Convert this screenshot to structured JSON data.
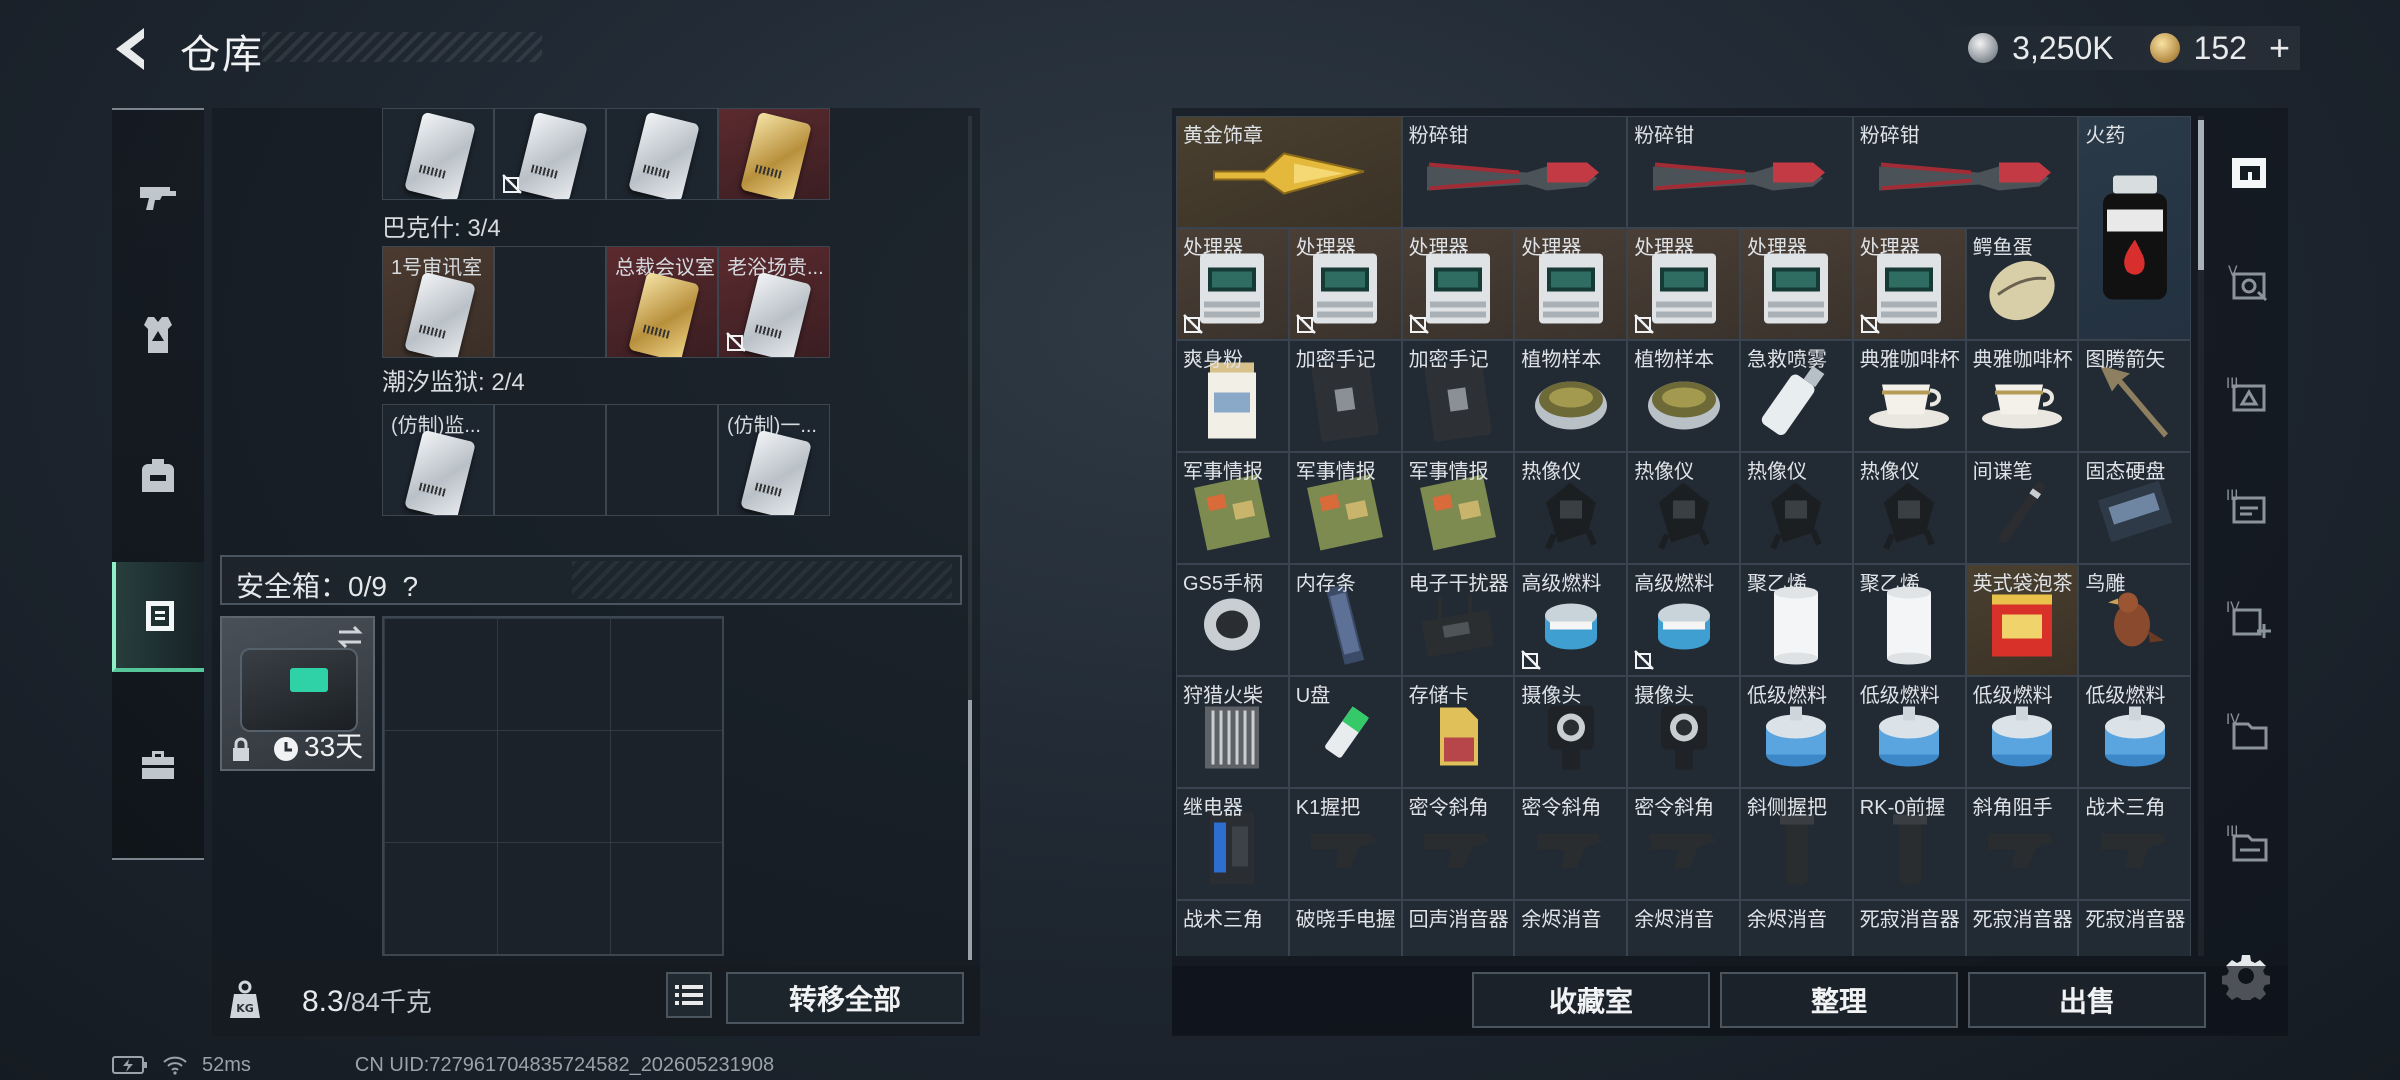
{
  "header": {
    "title": "仓库",
    "currency": [
      {
        "icon": "silver-coin-icon",
        "value": "3,250K"
      },
      {
        "icon": "gold-coin-icon",
        "value": "152"
      }
    ],
    "plus_label": "+"
  },
  "left_rail": {
    "items": [
      {
        "icon": "gun-icon",
        "active": false
      },
      {
        "icon": "armor-vest-icon",
        "active": false
      },
      {
        "icon": "backpack-icon",
        "active": false
      },
      {
        "icon": "safebox-icon",
        "active": true
      },
      {
        "icon": "briefcase-icon",
        "active": false
      }
    ]
  },
  "keys": {
    "groups": [
      {
        "label": "",
        "cells": [
          {
            "name": "",
            "card": "silver",
            "bound": false
          },
          {
            "name": "",
            "card": "silver",
            "bound": true
          },
          {
            "name": "",
            "card": "silver",
            "bound": false
          },
          {
            "name": "",
            "card": "gold",
            "bound": false
          }
        ]
      },
      {
        "label": "巴克什: 3/4",
        "cells": [
          {
            "name": "1号审讯室",
            "card": "silver",
            "bound": false,
            "bg": "orange"
          },
          {
            "name": "",
            "card": null,
            "bound": false
          },
          {
            "name": "总裁会议室",
            "card": "gold",
            "bound": false,
            "bg": "red"
          },
          {
            "name": "老浴场贵...",
            "card": "silver",
            "bound": true,
            "bg": "red"
          }
        ]
      },
      {
        "label": "潮汐监狱: 2/4",
        "cells": [
          {
            "name": "(仿制)监...",
            "card": "silver",
            "bound": false
          },
          {
            "name": "",
            "card": null,
            "bound": false
          },
          {
            "name": "",
            "card": null,
            "bound": false
          },
          {
            "name": "(仿制)一...",
            "card": "silver",
            "bound": false
          }
        ]
      }
    ]
  },
  "safebox": {
    "label": "安全箱：0/9",
    "help": "?",
    "days": "33天"
  },
  "bottom_left": {
    "weight": "8.3",
    "weight_max": "/84千克",
    "transfer_all": "转移全部"
  },
  "stash": {
    "rows": [
      [
        {
          "name": "黄金饰章",
          "span": 2,
          "bg": "gold",
          "art": "badge"
        },
        {
          "name": "粉碎钳",
          "span": 2,
          "art": "pliers"
        },
        {
          "name": "粉碎钳",
          "span": 2,
          "art": "pliers"
        },
        {
          "name": "粉碎钳",
          "span": 2,
          "art": "pliers"
        },
        {
          "name": "火药",
          "span": 1,
          "rowspan": 2,
          "bg": "blue",
          "art": "powder"
        }
      ],
      [
        {
          "name": "处理器",
          "bg": "orange",
          "art": "cpu",
          "bound": true
        },
        {
          "name": "处理器",
          "bg": "orange",
          "art": "cpu",
          "bound": true
        },
        {
          "name": "处理器",
          "bg": "orange",
          "art": "cpu",
          "bound": true
        },
        {
          "name": "处理器",
          "bg": "orange",
          "art": "cpu",
          "bound": false
        },
        {
          "name": "处理器",
          "bg": "orange",
          "art": "cpu",
          "bound": true
        },
        {
          "name": "处理器",
          "bg": "orange",
          "art": "cpu",
          "bound": false
        },
        {
          "name": "处理器",
          "bg": "orange",
          "art": "cpu",
          "bound": true
        },
        {
          "name": "鳄鱼蛋",
          "art": "egg"
        }
      ],
      [
        {
          "name": "爽身粉",
          "art": "can"
        },
        {
          "name": "加密手记",
          "art": "notebook"
        },
        {
          "name": "加密手记",
          "art": "notebook"
        },
        {
          "name": "植物样本",
          "art": "dish"
        },
        {
          "name": "植物样本",
          "art": "dish"
        },
        {
          "name": "急救喷雾",
          "art": "spray"
        },
        {
          "name": "典雅咖啡杯",
          "art": "cup"
        },
        {
          "name": "典雅咖啡杯",
          "art": "cup"
        },
        {
          "name": "图腾箭矢",
          "art": "arrow"
        }
      ],
      [
        {
          "name": "军事情报",
          "art": "board"
        },
        {
          "name": "军事情报",
          "art": "board"
        },
        {
          "name": "军事情报",
          "art": "board"
        },
        {
          "name": "热像仪",
          "art": "thermal"
        },
        {
          "name": "热像仪",
          "art": "thermal"
        },
        {
          "name": "热像仪",
          "art": "thermal"
        },
        {
          "name": "热像仪",
          "art": "thermal"
        },
        {
          "name": "间谍笔",
          "art": "pen"
        },
        {
          "name": "固态硬盘",
          "art": "ssd"
        }
      ],
      [
        {
          "name": "GS5手柄",
          "art": "gamepad"
        },
        {
          "name": "内存条",
          "art": "ram"
        },
        {
          "name": "电子干扰器",
          "art": "jammer"
        },
        {
          "name": "高级燃料",
          "art": "fuel",
          "bound": true
        },
        {
          "name": "高级燃料",
          "art": "fuel",
          "bound": true
        },
        {
          "name": "聚乙烯",
          "art": "roll"
        },
        {
          "name": "聚乙烯",
          "art": "roll"
        },
        {
          "name": "英式袋泡茶",
          "art": "tea",
          "bg": "gold"
        },
        {
          "name": "鸟雕",
          "art": "bird"
        }
      ],
      [
        {
          "name": "狩猎火柴",
          "art": "matches"
        },
        {
          "name": "U盘",
          "art": "usb"
        },
        {
          "name": "存储卡",
          "art": "sdcard"
        },
        {
          "name": "摄像头",
          "art": "camera"
        },
        {
          "name": "摄像头",
          "art": "camera"
        },
        {
          "name": "低级燃料",
          "art": "lowfuel"
        },
        {
          "name": "低级燃料",
          "art": "lowfuel"
        },
        {
          "name": "低级燃料",
          "art": "lowfuel"
        },
        {
          "name": "低级燃料",
          "art": "lowfuel"
        }
      ],
      [
        {
          "name": "继电器",
          "art": "relay"
        },
        {
          "name": "K1握把",
          "art": "grip"
        },
        {
          "name": "密令斜角",
          "art": "grip"
        },
        {
          "name": "密令斜角",
          "art": "grip"
        },
        {
          "name": "密令斜角",
          "art": "grip"
        },
        {
          "name": "斜侧握把",
          "art": "vgrip"
        },
        {
          "name": "RK-0前握",
          "art": "vgrip"
        },
        {
          "name": "斜角阻手",
          "art": "grip"
        },
        {
          "name": "战术三角",
          "art": "grip"
        }
      ],
      [
        {
          "name": "战术三角",
          "art": "none"
        },
        {
          "name": "破晓手电握",
          "art": "none"
        },
        {
          "name": "回声消音器",
          "art": "none"
        },
        {
          "name": "余烬消音",
          "art": "none"
        },
        {
          "name": "余烬消音",
          "art": "none"
        },
        {
          "name": "余烬消音",
          "art": "none"
        },
        {
          "name": "死寂消音器",
          "art": "none"
        },
        {
          "name": "死寂消音器",
          "art": "none"
        },
        {
          "name": "死寂消音器",
          "art": "none"
        }
      ]
    ]
  },
  "right_rail": {
    "items": [
      {
        "icon": "stash-home-icon",
        "active": true
      },
      {
        "icon": "vault-v-icon"
      },
      {
        "icon": "vault-iii-a-icon"
      },
      {
        "icon": "vault-iii-b-icon"
      },
      {
        "icon": "vault-iv-plus-icon"
      },
      {
        "icon": "vault-iv-icon"
      },
      {
        "icon": "vault-iii-c-icon"
      }
    ]
  },
  "bottom_right": {
    "collection": "收藏室",
    "sort": "整理",
    "sell": "出售"
  },
  "status": {
    "ping": "52ms",
    "uid": "CN UID:727961704835724582_202605231908"
  }
}
